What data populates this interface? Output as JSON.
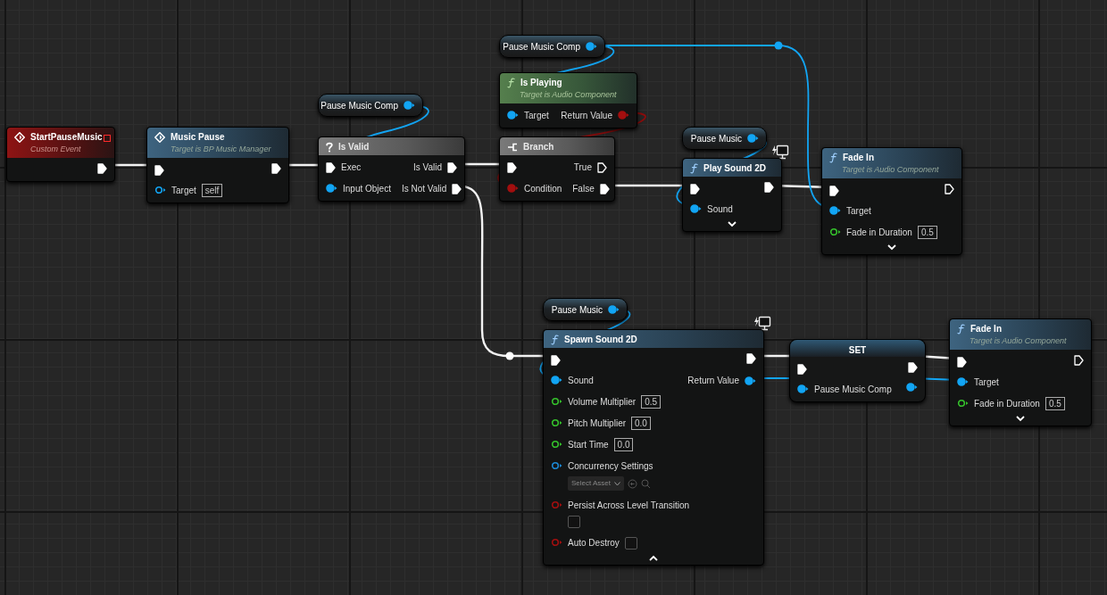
{
  "nodes": [
    {
      "kind": "event",
      "title": "StartPauseMusic",
      "subtitle": "Custom Event",
      "delegate_pin": true,
      "rows": [
        {
          "right": {
            "kind": "exec",
            "connected": true
          }
        }
      ]
    },
    {
      "kind": "event_call",
      "title": "Music Pause",
      "subtitle": "Target is BP Music Manager",
      "rows": [
        {
          "left": {
            "kind": "exec",
            "connected": true
          },
          "right": {
            "kind": "exec",
            "connected": true
          }
        },
        {
          "left": {
            "kind": "object",
            "label": "Target",
            "connected": false,
            "value": "self"
          }
        }
      ]
    },
    {
      "kind": "variable",
      "title": "Pause Music Comp",
      "rows": [
        {
          "right": {
            "kind": "object",
            "connected": true
          }
        }
      ]
    },
    {
      "kind": "macro",
      "title": "Is Valid",
      "rows": [
        {
          "left": {
            "kind": "exec",
            "label": "Exec",
            "connected": true
          },
          "right": {
            "kind": "exec",
            "label": "Is Valid",
            "connected": true
          }
        },
        {
          "left": {
            "kind": "object",
            "label": "Input Object",
            "connected": true
          },
          "right": {
            "kind": "exec",
            "label": "Is Not Valid",
            "connected": true
          }
        }
      ]
    },
    {
      "kind": "variable",
      "title": "Pause Music Comp",
      "rows": [
        {
          "right": {
            "kind": "object",
            "connected": true
          }
        }
      ]
    },
    {
      "kind": "pure_function",
      "title": "Is Playing",
      "subtitle": "Target is Audio Component",
      "rows": [
        {
          "left": {
            "kind": "object",
            "label": "Target",
            "connected": true
          },
          "right": {
            "kind": "bool",
            "label": "Return Value",
            "connected": true
          }
        }
      ]
    },
    {
      "kind": "branch",
      "title": "Branch",
      "rows": [
        {
          "left": {
            "kind": "exec",
            "connected": true
          },
          "right": {
            "kind": "exec",
            "label": "True",
            "connected": false
          }
        },
        {
          "left": {
            "kind": "bool",
            "label": "Condition",
            "connected": true
          },
          "right": {
            "kind": "exec",
            "label": "False",
            "connected": true
          }
        }
      ]
    },
    {
      "kind": "variable",
      "title": "Pause Music",
      "rows": [
        {
          "right": {
            "kind": "object",
            "connected": true
          }
        }
      ]
    },
    {
      "kind": "function",
      "title": "Play Sound 2D",
      "client_icon": true,
      "advanced_expanded": false,
      "rows": [
        {
          "left": {
            "kind": "exec",
            "connected": true
          },
          "right": {
            "kind": "exec",
            "connected": true
          }
        },
        {
          "left": {
            "kind": "object",
            "label": "Sound",
            "connected": true
          }
        }
      ]
    },
    {
      "kind": "function",
      "title": "Fade In",
      "subtitle": "Target is Audio Component",
      "advanced_expanded": false,
      "rows": [
        {
          "left": {
            "kind": "exec",
            "connected": true
          },
          "right": {
            "kind": "exec",
            "connected": false
          }
        },
        {
          "left": {
            "kind": "object",
            "label": "Target",
            "connected": true
          }
        },
        {
          "left": {
            "kind": "float",
            "label": "Fade in Duration",
            "connected": false,
            "value": "0.5"
          }
        }
      ]
    },
    {
      "kind": "variable",
      "title": "Pause Music",
      "rows": [
        {
          "right": {
            "kind": "object",
            "connected": true
          }
        }
      ]
    },
    {
      "kind": "function",
      "title": "Spawn Sound 2D",
      "client_icon": true,
      "advanced_expanded": true,
      "rows": [
        {
          "left": {
            "kind": "exec",
            "connected": true
          },
          "right": {
            "kind": "exec",
            "connected": true
          }
        },
        {
          "left": {
            "kind": "object",
            "label": "Sound",
            "connected": true
          },
          "right": {
            "kind": "object",
            "label": "Return Value",
            "connected": true
          }
        },
        {
          "left": {
            "kind": "float",
            "label": "Volume Multiplier",
            "connected": false,
            "value": "0.5"
          }
        },
        {
          "left": {
            "kind": "float",
            "label": "Pitch Multiplier",
            "connected": false,
            "value": "0.0"
          }
        },
        {
          "left": {
            "kind": "float",
            "label": "Start Time",
            "connected": false,
            "value": "0.0"
          }
        },
        {
          "left": {
            "kind": "asset",
            "label": "Concurrency Settings",
            "connected": false,
            "value": "Select Asset"
          }
        },
        {
          "left": {
            "kind": "bool",
            "label": "Persist Across Level Transition",
            "connected": false,
            "checked": false
          }
        },
        {
          "left": {
            "kind": "bool",
            "label": "Auto Destroy",
            "connected": false,
            "checked": false
          }
        }
      ]
    },
    {
      "kind": "set",
      "title": "SET",
      "rows": [
        {
          "left": {
            "kind": "exec",
            "connected": true
          },
          "right": {
            "kind": "exec",
            "connected": true
          }
        },
        {
          "left": {
            "kind": "object",
            "label": "Pause Music Comp",
            "connected": true
          },
          "right": {
            "kind": "object",
            "connected": true
          }
        }
      ]
    },
    {
      "kind": "function",
      "title": "Fade In",
      "subtitle": "Target is Audio Component",
      "advanced_expanded": false,
      "rows": [
        {
          "left": {
            "kind": "exec",
            "connected": true
          },
          "right": {
            "kind": "exec",
            "connected": false
          }
        },
        {
          "left": {
            "kind": "object",
            "label": "Target",
            "connected": true
          }
        },
        {
          "left": {
            "kind": "float",
            "label": "Fade in Duration",
            "connected": false,
            "value": "0.5"
          }
        }
      ]
    }
  ]
}
